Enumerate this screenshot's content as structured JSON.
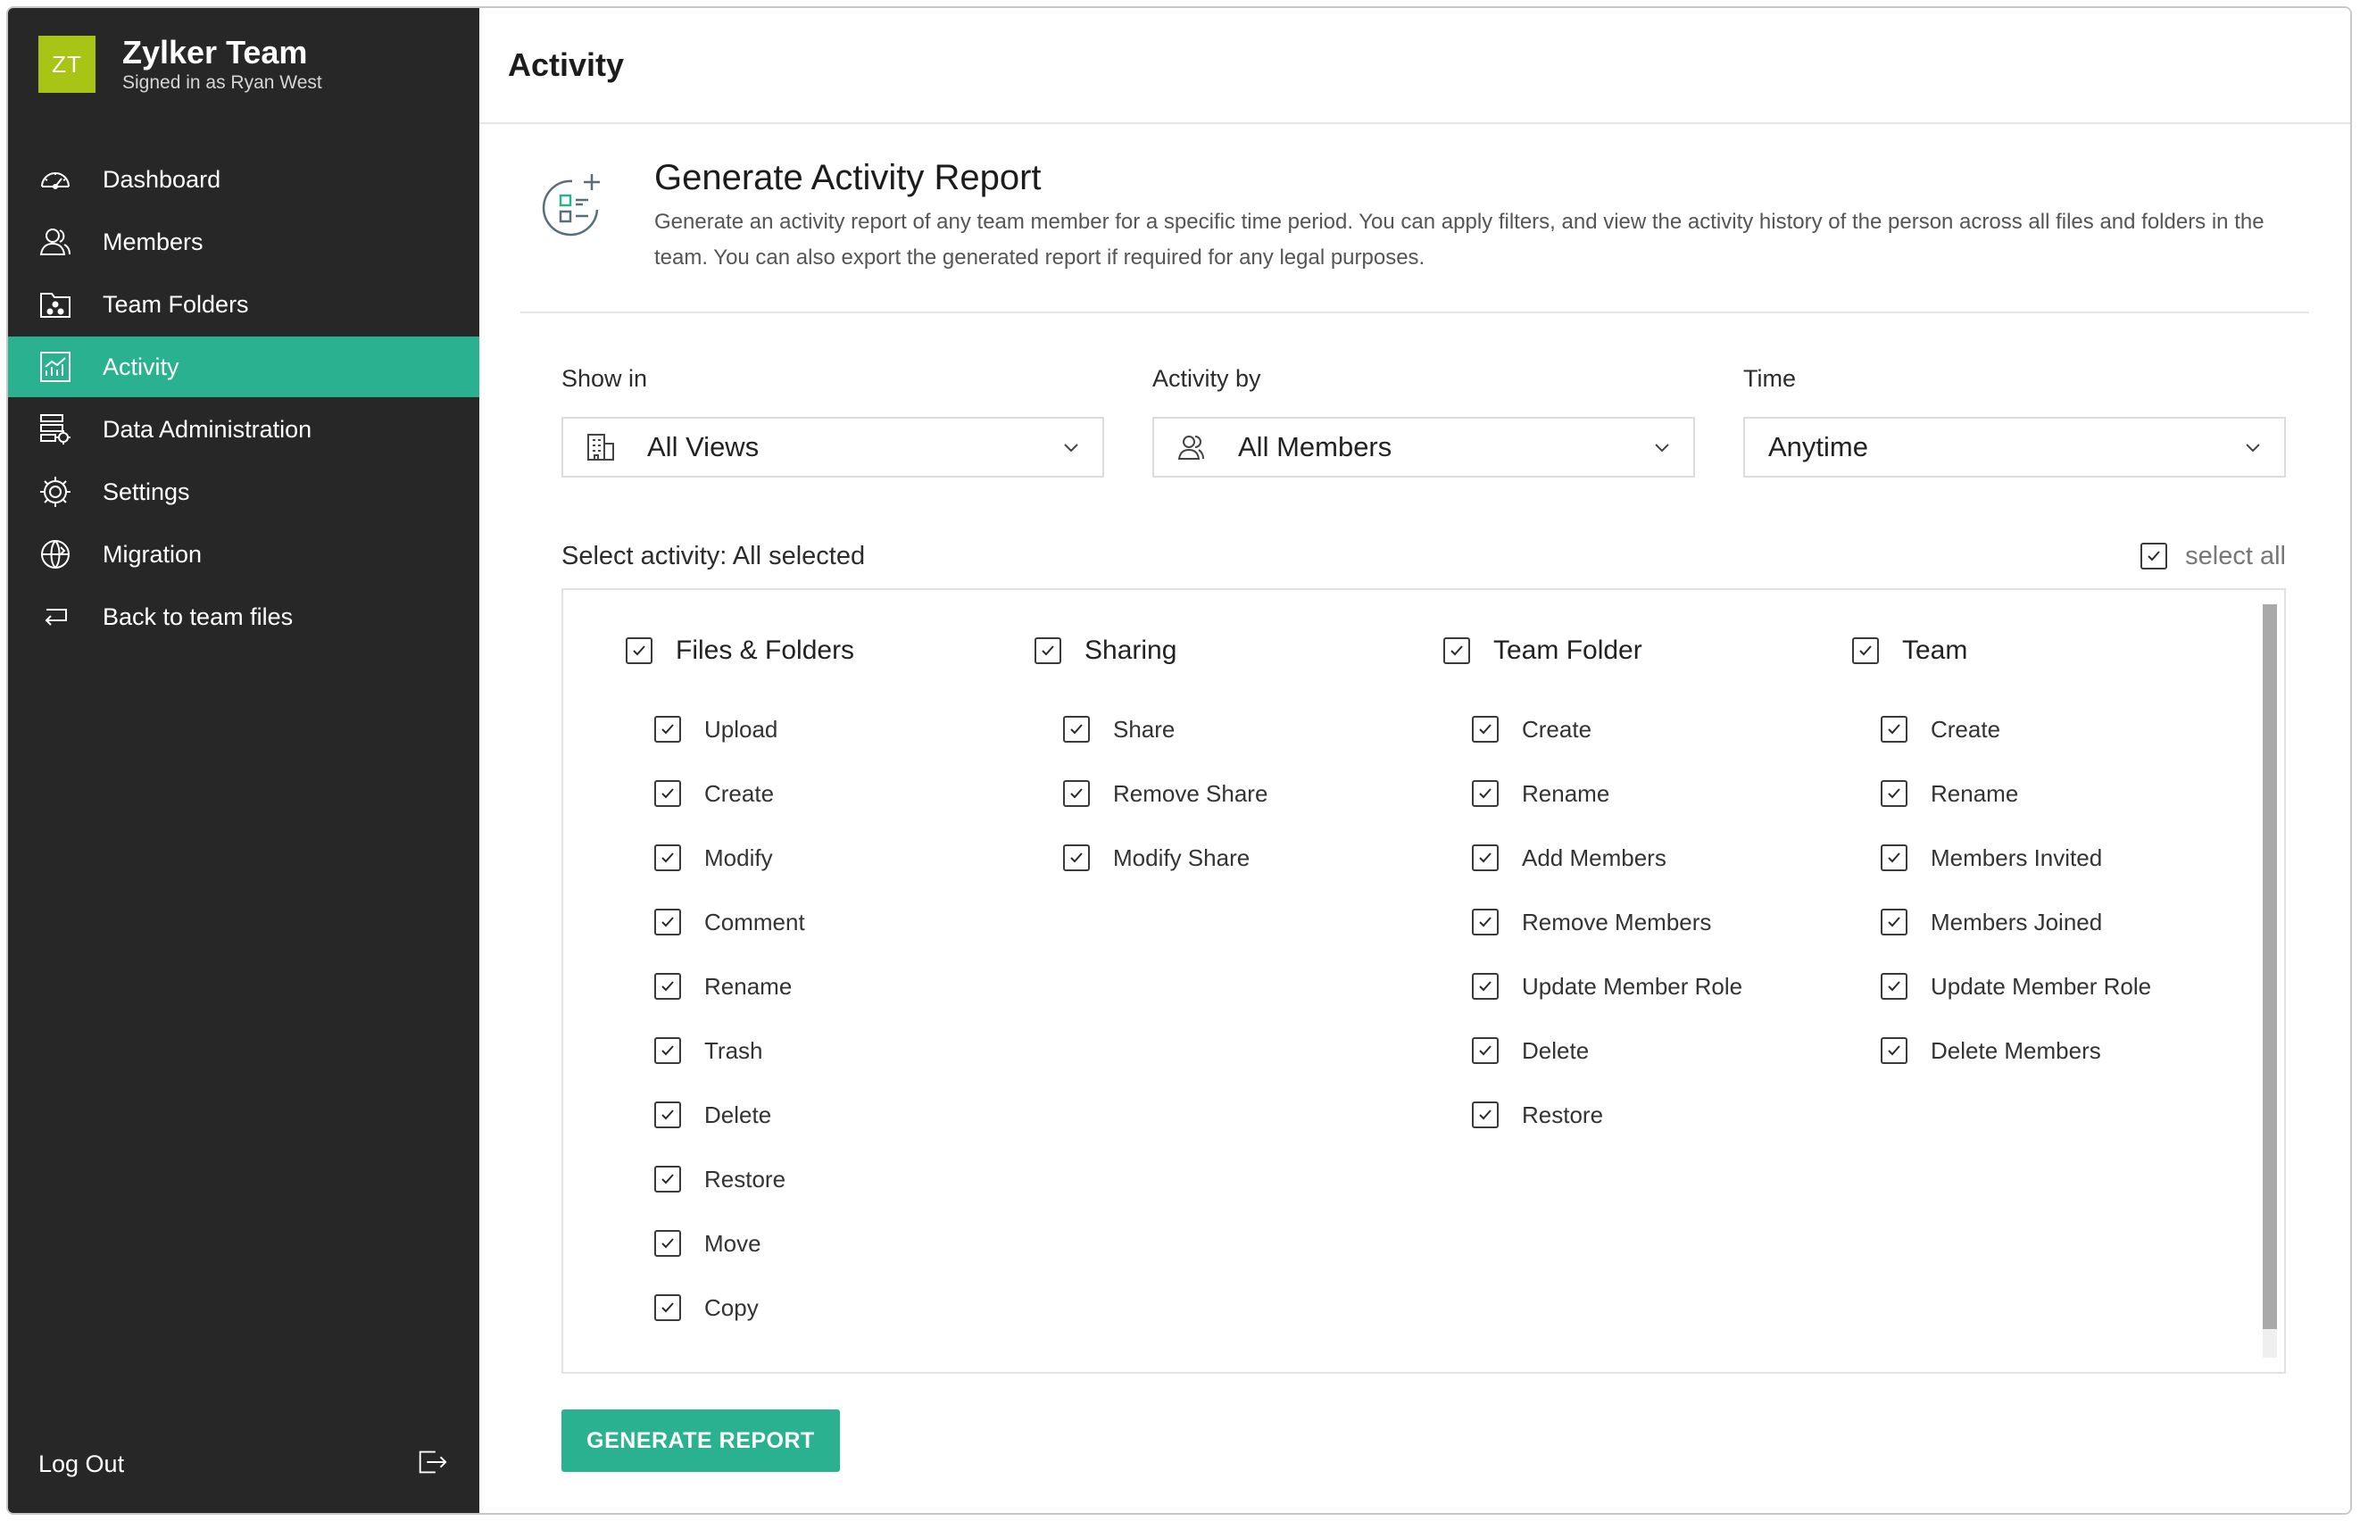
{
  "brand": {
    "initials": "ZT",
    "name": "Zylker Team",
    "subtitle": "Signed in as Ryan West",
    "logo_color": "#a8c515"
  },
  "sidebar": {
    "items": [
      {
        "label": "Dashboard",
        "icon": "dashboard-icon",
        "active": false
      },
      {
        "label": "Members",
        "icon": "members-icon",
        "active": false
      },
      {
        "label": "Team Folders",
        "icon": "team-folders-icon",
        "active": false
      },
      {
        "label": "Activity",
        "icon": "activity-icon",
        "active": true
      },
      {
        "label": "Data Administration",
        "icon": "data-administration-icon",
        "active": false
      },
      {
        "label": "Settings",
        "icon": "settings-icon",
        "active": false
      },
      {
        "label": "Migration",
        "icon": "migration-icon",
        "active": false
      },
      {
        "label": "Back to team files",
        "icon": "back-arrow-icon",
        "active": false
      }
    ],
    "logout_label": "Log Out",
    "logout_icon": "logout-icon",
    "active_color": "#2ab18f",
    "background": "#272727"
  },
  "header": {
    "title": "Activity"
  },
  "intro": {
    "icon": "report-icon",
    "title": "Generate Activity Report",
    "description": "Generate an activity report of any team member for a specific time period. You can apply filters, and view the activity history of the person across all files and folders in the team. You can also export the generated report if required for any legal purposes."
  },
  "filters": {
    "show_in": {
      "label": "Show in",
      "value": "All Views",
      "icon": "building-icon"
    },
    "activity_by": {
      "label": "Activity by",
      "value": "All Members",
      "icon": "members-icon"
    },
    "time": {
      "label": "Time",
      "value": "Anytime"
    }
  },
  "select_activity": {
    "label": "Select activity: All selected",
    "select_all_label": "select all",
    "select_all_checked": true
  },
  "groups": [
    {
      "label": "Files & Folders",
      "checked": true,
      "items": [
        "Upload",
        "Create",
        "Modify",
        "Comment",
        "Rename",
        "Trash",
        "Delete",
        "Restore",
        "Move",
        "Copy"
      ]
    },
    {
      "label": "Sharing",
      "checked": true,
      "items": [
        "Share",
        "Remove Share",
        "Modify Share"
      ]
    },
    {
      "label": "Team Folder",
      "checked": true,
      "items": [
        "Create",
        "Rename",
        "Add Members",
        "Remove Members",
        "Update Member Role",
        "Delete",
        "Restore"
      ]
    },
    {
      "label": "Team",
      "checked": true,
      "items": [
        "Create",
        "Rename",
        "Members Invited",
        "Members Joined",
        "Update Member Role",
        "Delete Members"
      ]
    }
  ],
  "generate_button": {
    "label": "GENERATE REPORT"
  }
}
